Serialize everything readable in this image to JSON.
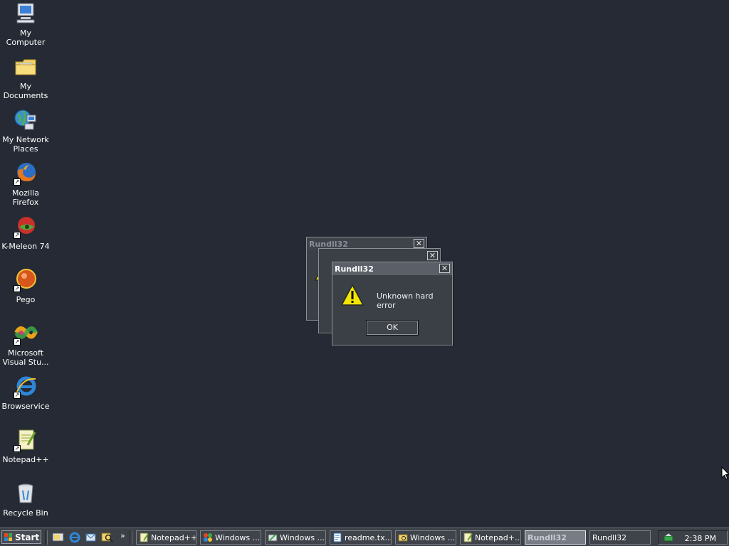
{
  "desktop": {
    "icons": [
      {
        "label": "My Computer",
        "icon": "computer-icon"
      },
      {
        "label": "My Documents",
        "icon": "folder-icon"
      },
      {
        "label": "My Network Places",
        "icon": "network-icon"
      },
      {
        "label": "Mozilla Firefox",
        "icon": "firefox-icon"
      },
      {
        "label": "K-Meleon 74",
        "icon": "k-meleon-icon"
      },
      {
        "label": "Pego",
        "icon": "pego-icon"
      },
      {
        "label": "Microsoft Visual Stu...",
        "icon": "visual-studio-icon"
      },
      {
        "label": "Browservice",
        "icon": "ie-icon"
      },
      {
        "label": "Notepad++",
        "icon": "notepad-plus-plus-icon"
      },
      {
        "label": "Recycle Bin",
        "icon": "recycle-bin-icon"
      }
    ]
  },
  "dialogs": {
    "back": {
      "title": "Rundll32",
      "close": "✕"
    },
    "middle": {
      "close": "✕"
    },
    "front": {
      "title": "Rundll32",
      "close": "✕",
      "message": "Unknown hard error",
      "ok": "OK"
    }
  },
  "taskbar": {
    "start_label": "Start",
    "chevron": "»",
    "quick_launch": [
      "show-desktop-icon",
      "ie-icon",
      "outlook-icon",
      "search-icon"
    ],
    "tasks": [
      {
        "label": "Notepad++",
        "icon": "notepad-plus-plus-icon",
        "active": false
      },
      {
        "label": "Windows ...",
        "icon": "windows-explorer-icon",
        "active": false
      },
      {
        "label": "Windows ...",
        "icon": "windows-tool-icon",
        "active": false
      },
      {
        "label": "readme.tx...",
        "icon": "text-file-icon",
        "active": false
      },
      {
        "label": "Windows ...",
        "icon": "windows-explorer-icon",
        "active": false
      },
      {
        "label": "Notepad+...",
        "icon": "notepad-plus-plus-icon",
        "active": false
      },
      {
        "label": "Rundll32",
        "icon": "",
        "active": true
      },
      {
        "label": "Rundll32",
        "icon": "",
        "active": false
      }
    ],
    "clock": "2:38 PM"
  },
  "colors": {
    "desktop": "#252a34",
    "warning": "#f2e600"
  }
}
